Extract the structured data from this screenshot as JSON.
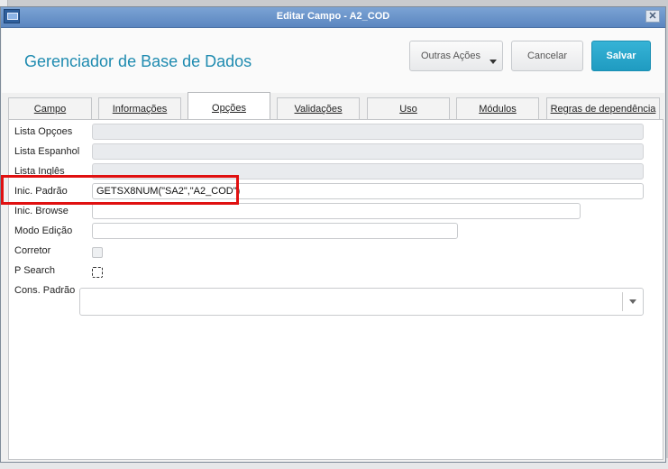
{
  "window": {
    "title": "Editar Campo - A2_COD",
    "close_glyph": "✕"
  },
  "header": {
    "app_title": "Gerenciador de Base de Dados",
    "buttons": {
      "outras": "Outras Ações",
      "cancel": "Cancelar",
      "save": "Salvar"
    }
  },
  "tabs": [
    "Campo",
    "Informações",
    "Opções",
    "Validações",
    "Uso",
    "Módulos",
    "Regras de dependência"
  ],
  "active_tab": "Opções",
  "form": {
    "lista_opcoes": {
      "label": "Lista Opçoes",
      "value": ""
    },
    "lista_espanhol": {
      "label": "Lista Espanhol",
      "value": ""
    },
    "lista_ingles": {
      "label": "Lista Inglês",
      "value": ""
    },
    "inic_padrao": {
      "label": "Inic. Padrão",
      "value": "GETSX8NUM(\"SA2\",\"A2_COD\")"
    },
    "inic_browse": {
      "label": "Inic. Browse",
      "value": ""
    },
    "modo_edicao": {
      "label": "Modo Edição",
      "value": ""
    },
    "corretor": {
      "label": "Corretor",
      "checked": false
    },
    "p_search": {
      "label": "P Search",
      "checked": false
    },
    "cons_padrao": {
      "label": "Cons. Padrão",
      "value": ""
    }
  },
  "colors": {
    "accent": "#1f8bb0",
    "save": "#1f9bc1",
    "highlight": "#e01010",
    "titlebar": "#5b86c0"
  },
  "icons": {
    "app": "app-window-icon",
    "close": "close-icon",
    "dropdown": "chevron-down-icon"
  }
}
